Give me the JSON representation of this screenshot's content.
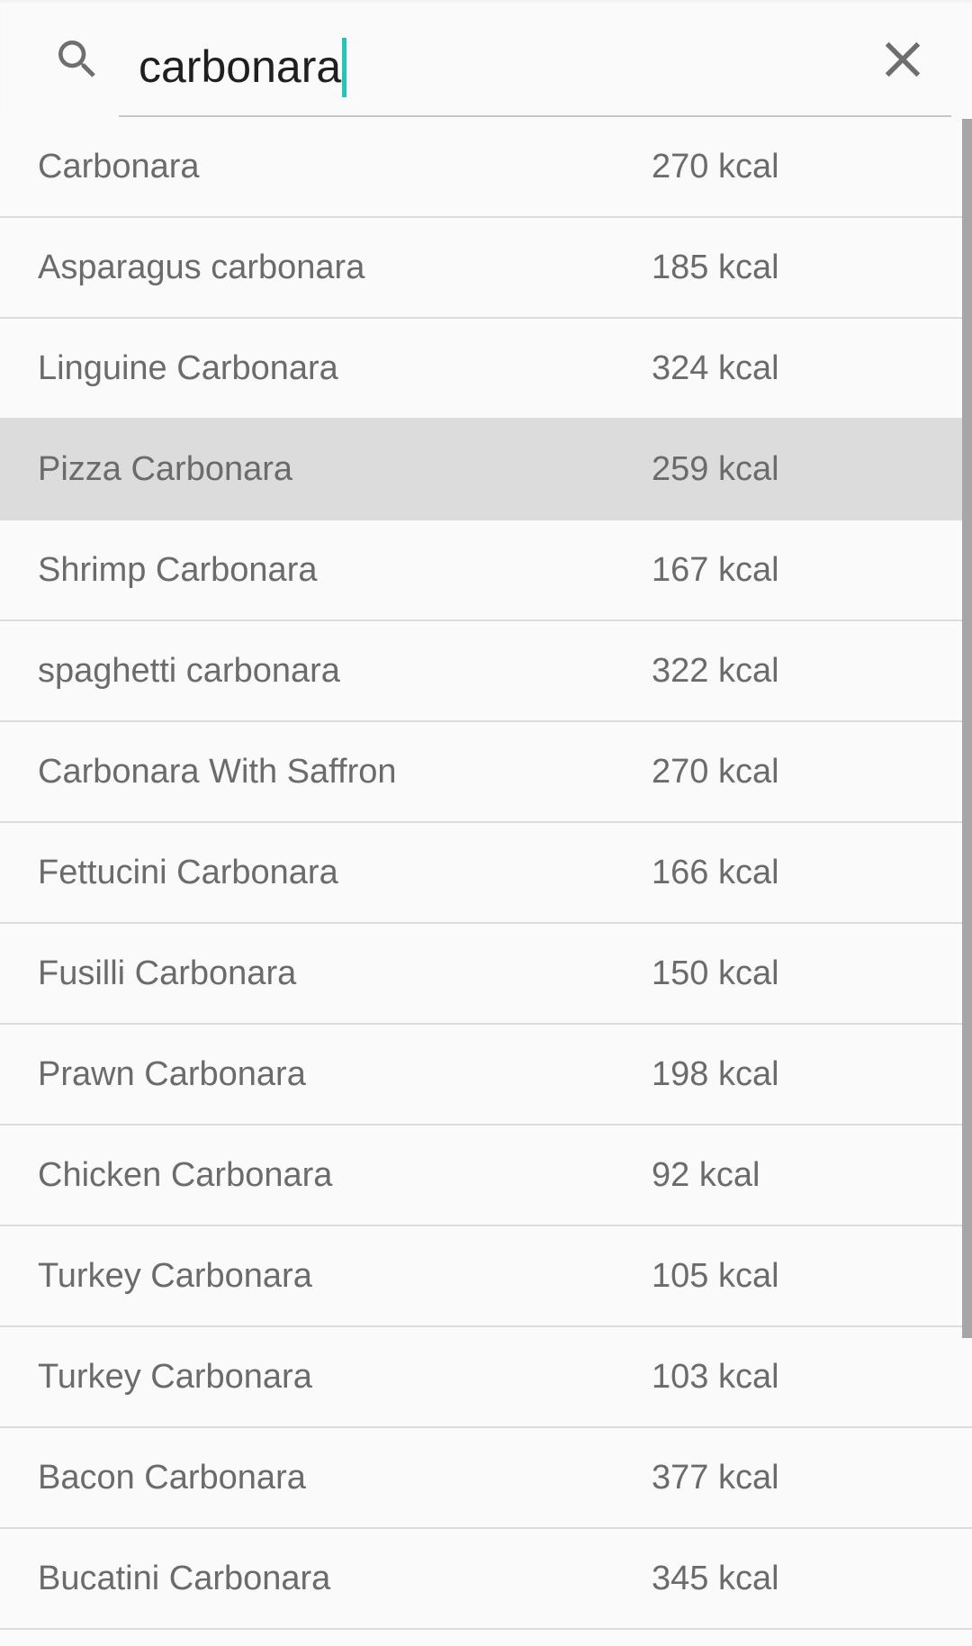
{
  "search": {
    "query": "carbonara",
    "accent_color": "#26c4b8"
  },
  "icons": {
    "search": "search-icon",
    "clear": "close-icon"
  },
  "results": [
    {
      "name": "Carbonara",
      "kcal": "270 kcal",
      "highlighted": false
    },
    {
      "name": "Asparagus carbonara",
      "kcal": "185 kcal",
      "highlighted": false
    },
    {
      "name": "Linguine Carbonara",
      "kcal": "324 kcal",
      "highlighted": false
    },
    {
      "name": "Pizza Carbonara",
      "kcal": "259 kcal",
      "highlighted": true
    },
    {
      "name": "Shrimp Carbonara",
      "kcal": "167 kcal",
      "highlighted": false
    },
    {
      "name": "spaghetti carbonara",
      "kcal": "322 kcal",
      "highlighted": false
    },
    {
      "name": "Carbonara With Saffron",
      "kcal": "270 kcal",
      "highlighted": false
    },
    {
      "name": "Fettucini Carbonara",
      "kcal": "166 kcal",
      "highlighted": false
    },
    {
      "name": "Fusilli Carbonara",
      "kcal": "150 kcal",
      "highlighted": false
    },
    {
      "name": "Prawn Carbonara",
      "kcal": "198 kcal",
      "highlighted": false
    },
    {
      "name": "Chicken Carbonara",
      "kcal": "92 kcal",
      "highlighted": false
    },
    {
      "name": "Turkey Carbonara",
      "kcal": "105 kcal",
      "highlighted": false
    },
    {
      "name": "Turkey Carbonara",
      "kcal": "103 kcal",
      "highlighted": false
    },
    {
      "name": "Bacon Carbonara",
      "kcal": "377 kcal",
      "highlighted": false
    },
    {
      "name": "Bucatini Carbonara",
      "kcal": "345 kcal",
      "highlighted": false
    }
  ]
}
